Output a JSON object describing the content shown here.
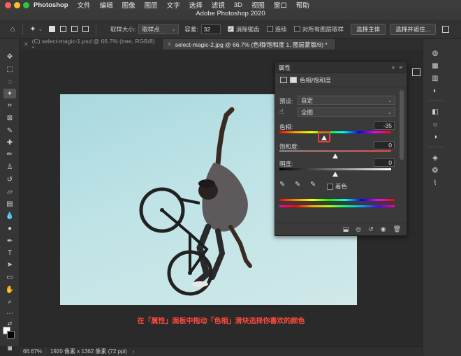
{
  "menubar": {
    "app": "Photoshop",
    "items": [
      "文件",
      "编辑",
      "图像",
      "图层",
      "文字",
      "选择",
      "滤镜",
      "3D",
      "视图",
      "窗口",
      "帮助"
    ],
    "window_title": "Adobe Photoshop 2020"
  },
  "options_bar": {
    "sample_size_label": "取样大小:",
    "sample_size_value": "取样点",
    "tolerance_label": "容差:",
    "tolerance_value": "32",
    "anti_alias_label": "消除锯齿",
    "anti_alias_checked": true,
    "contiguous_label": "连续",
    "contiguous_checked": false,
    "all_layers_label": "对所有图层取样",
    "all_layers_checked": false,
    "select_subject_label": "选择主体",
    "select_mask_label": "选择并遮住..."
  },
  "tabs": [
    {
      "label": "(C) select-magic-1.psd @ 66.7% (tree, RGB/8) *",
      "active": false
    },
    {
      "label": "select-magic-2.jpg @ 66.7% (色相/饱和度 1, 图层蒙版/8) *",
      "active": true
    }
  ],
  "properties": {
    "panel_title": "属性",
    "adjustment_name": "色相/饱和度",
    "preset_label": "预设:",
    "preset_value": "自定",
    "channel_value": "全图",
    "hue_label": "色相:",
    "hue_value": "-35",
    "hue_fraction": 0.403,
    "saturation_label": "饱和度:",
    "saturation_value": "0",
    "saturation_fraction": 0.5,
    "lightness_label": "明度:",
    "lightness_value": "0",
    "lightness_fraction": 0.5,
    "colorize_label": "着色",
    "colorize_checked": false
  },
  "caption": "在「属性」面板中拖动「色相」滑块选择你喜欢的颜色",
  "status": {
    "zoom": "66.67%",
    "doc_info": "1920 像素 x 1362 像素 (72 ppi)"
  },
  "colors": {
    "accent_highlight": "#ff3b30",
    "caption": "#ff4a3d"
  }
}
